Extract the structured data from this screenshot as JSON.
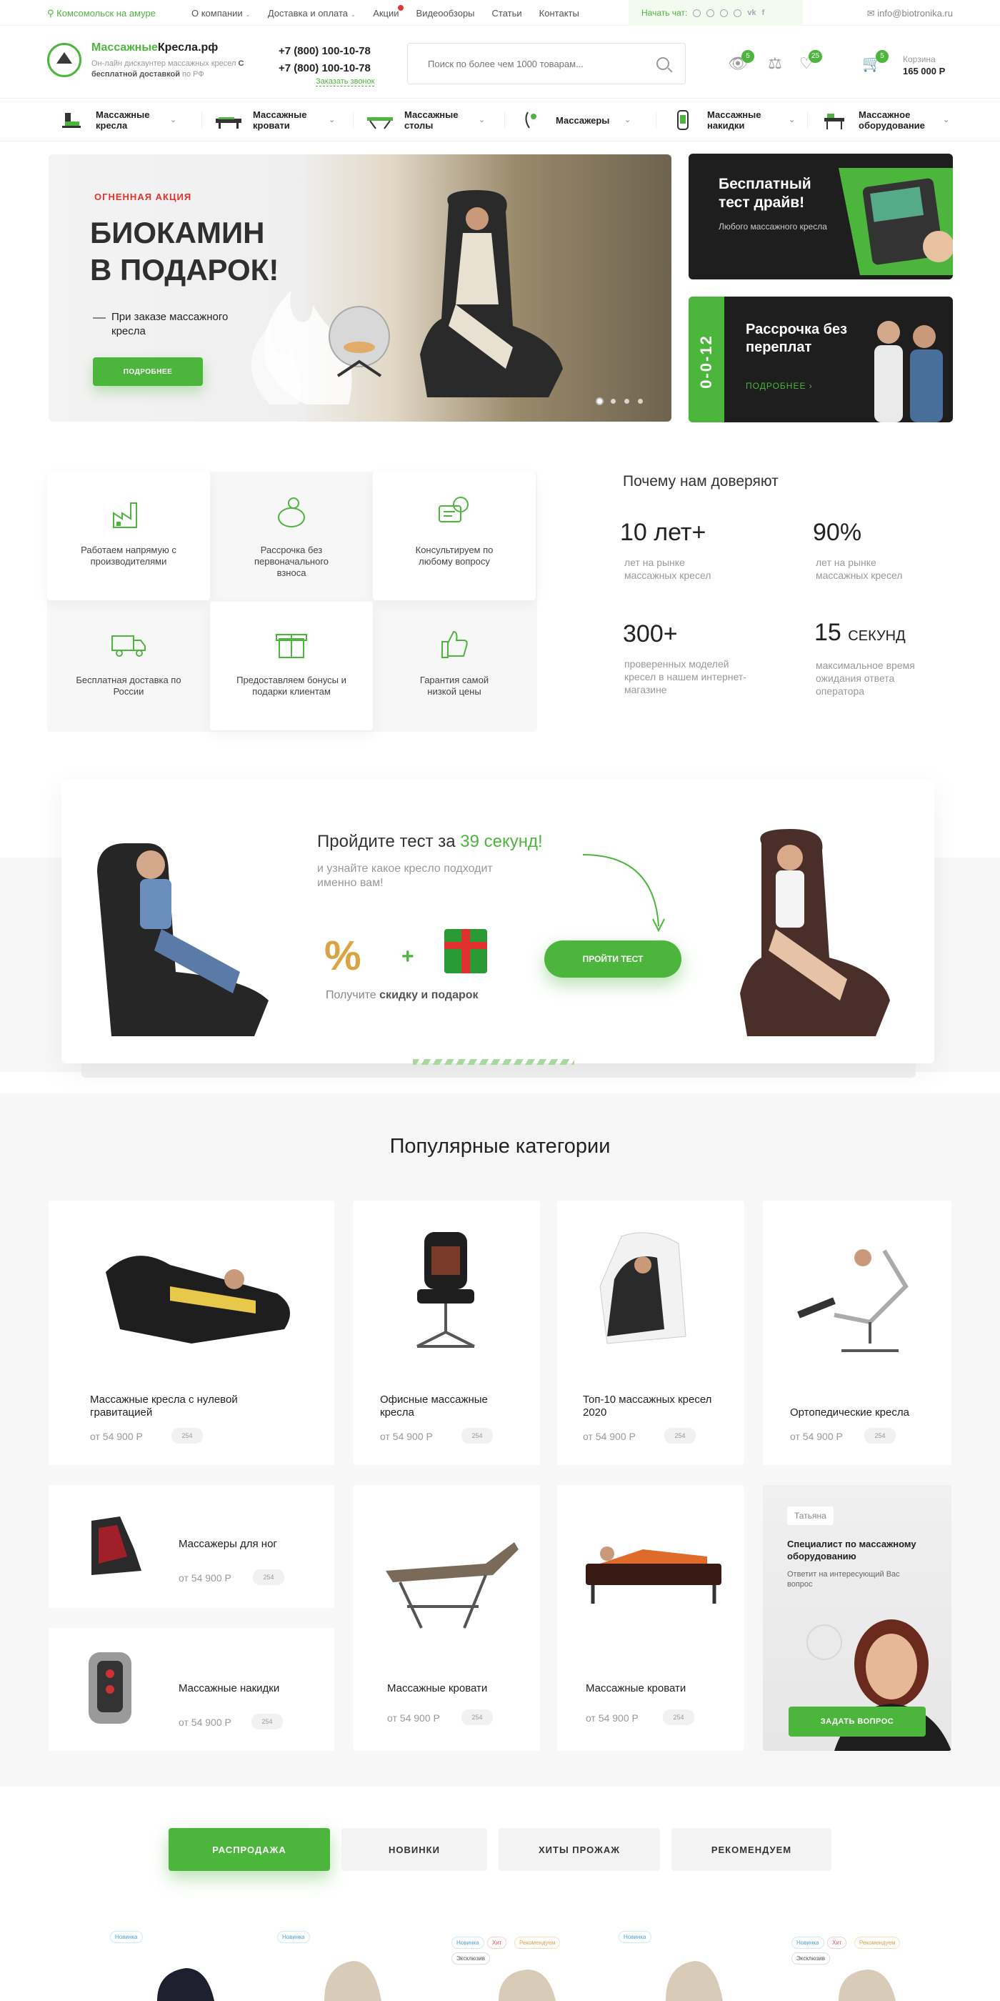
{
  "topbar": {
    "city": "Комсомольск на амуре",
    "menu": [
      "О компании",
      "Доставка и оплата",
      "Акции",
      "Видеообзоры",
      "Статьи",
      "Контакты"
    ],
    "chat_label": "Начать чат:",
    "email": "info@biotronika.ru"
  },
  "header": {
    "brand_green": "Массажные",
    "brand_dark": "Кресла.рф",
    "tagline_pre": "Он-лайн дискаунтер массажных кресел ",
    "tagline_bold": "С бесплатной доставкой",
    "tagline_post": " по РФ",
    "phone1": "+7 (800) 100-10-78",
    "phone2": "+7 (800) 100-10-78",
    "callback": "Заказать звонок",
    "search_placeholder": "Поиск по более чем 1000 товарам...",
    "views_count": "5",
    "compare_count": "",
    "favorites_count": "25",
    "cart_count": "5",
    "cart_label": "Корзина",
    "cart_sum": "165 000 Р"
  },
  "catnav": [
    {
      "label": "Массажные кресла",
      "icon": "massage-chair-icon"
    },
    {
      "label": "Массажные кровати",
      "icon": "massage-bed-icon"
    },
    {
      "label": "Массажные столы",
      "icon": "massage-table-icon"
    },
    {
      "label": "Массажеры",
      "icon": "massager-icon"
    },
    {
      "label": "Массажные накидки",
      "icon": "massage-cape-icon"
    },
    {
      "label": "Массажное оборудование",
      "icon": "equipment-icon"
    }
  ],
  "hero": {
    "tag": "ОГНЕННАЯ АКЦИЯ",
    "title_line1": "БИОКАМИН",
    "title_line2": "В ПОДАРОК!",
    "subtitle": "При заказе массажного кресла",
    "button": "ПОДРОБНЕЕ",
    "slides": 4,
    "active_slide": 1
  },
  "promo_test_drive": {
    "title": "Бесплатный тест драйв!",
    "subtitle": "Любого массажного кресла"
  },
  "promo_installment": {
    "side": "0-0-12",
    "title": "Рассрочка без переплат",
    "more": "ПОДРОБНЕЕ"
  },
  "features": [
    {
      "text": "Работаем напрямую с производителями",
      "icon": "factory-icon"
    },
    {
      "text": "Рассрочка без первоначального взноса",
      "icon": "piggy-bank-icon"
    },
    {
      "text": "Консультируем по любому вопросу",
      "icon": "consult-icon"
    },
    {
      "text": "Бесплатная доставка по России",
      "icon": "delivery-truck-icon"
    },
    {
      "text": "Предоставляем бонусы и подарки клиентам",
      "icon": "gift-icon"
    },
    {
      "text": "Гарантия самой низкой цены",
      "icon": "thumbs-up-icon"
    }
  ],
  "trust": {
    "title": "Почему нам доверяют",
    "stats": [
      {
        "value": "10 лет+",
        "unit": "",
        "desc": "лет на рынке массажных кресел"
      },
      {
        "value": "90%",
        "unit": "",
        "desc": "лет на рынке массажных кресел"
      },
      {
        "value": "300+",
        "unit": "",
        "desc": "проверенных моделей кресел в нашем интернет-магазине"
      },
      {
        "value": "15",
        "unit": "секунд",
        "desc": "максимальное время ожидания ответа оператора"
      }
    ]
  },
  "quiz": {
    "title_pre": "Пройдите тест за ",
    "title_green": "39 секунд!",
    "subtitle": "и узнайте какое кресло подходит именно вам!",
    "note_pre": "Получите ",
    "note_bold": "скидку и подарок",
    "button": "ПРОЙТИ ТЕСТ",
    "percent_sign": "%",
    "plus": "+"
  },
  "popular": {
    "title": "Популярные категории",
    "cards": [
      {
        "name": "Массажные кресла с нулевой гравитацией",
        "price": "от 54 900 Р",
        "count": "254"
      },
      {
        "name": "Офисные массажные кресла",
        "price": "от 54 900 Р",
        "count": "254"
      },
      {
        "name": "Топ-10 массажных кресел 2020",
        "price": "от 54 900 Р",
        "count": "254"
      },
      {
        "name": "Ортопедические кресла",
        "price": "от 54 900 Р",
        "count": "254"
      },
      {
        "name": "Массажеры для ног",
        "price": "от 54 900 Р",
        "count": "254"
      },
      {
        "name": "Массажные накидки",
        "price": "от 54 900 Р",
        "count": "254"
      },
      {
        "name": "Массажные кровати",
        "price": "от 54 900 Р",
        "count": "254"
      },
      {
        "name": "Массажные кровати",
        "price": "от 54 900 Р",
        "count": "254"
      }
    ],
    "specialist": {
      "name": "Татьяна",
      "title": "Специалист по массажному оборудованию",
      "subtitle": "Ответит на интересующий Вас вопрос",
      "button": "ЗАДАТЬ ВОПРОС"
    }
  },
  "tabs": [
    "РАСПРОДАЖА",
    "НОВИНКИ",
    "ХИТЫ ПРОЖАЖ",
    "РЕКОМЕНДУЕМ"
  ],
  "products": [
    {
      "chips": [
        "Новинка"
      ]
    },
    {
      "chips": [
        "Новинка"
      ]
    },
    {
      "chips": [
        "Новинка",
        "Хит",
        "Рекомендуем",
        "Эксклюзив"
      ]
    },
    {
      "chips": [
        "Новинка"
      ]
    },
    {
      "chips": [
        "Новинка",
        "Хит",
        "Рекомендуем",
        "Эксклюзив"
      ]
    }
  ],
  "colors": {
    "accent": "#4cb63c",
    "sale": "#e3322b",
    "dark": "#1e1e1e"
  }
}
